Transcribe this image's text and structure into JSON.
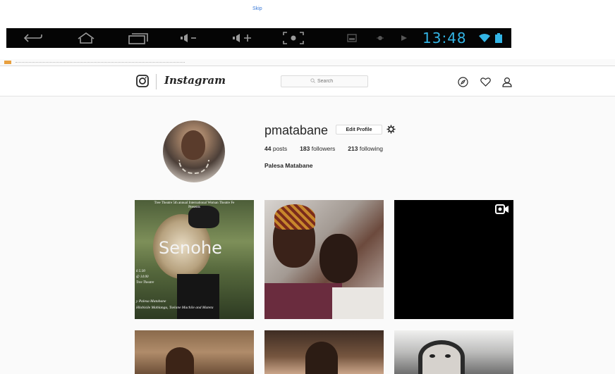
{
  "overlay": {
    "skip_label": "Skip"
  },
  "android_bar": {
    "time": "13:48",
    "icons": [
      "back-icon",
      "home-icon",
      "recents-icon",
      "volume-down-icon",
      "volume-up-icon",
      "screenshot-icon",
      "notification-icon",
      "usb-icon",
      "play-icon",
      "wifi-icon",
      "battery-icon"
    ]
  },
  "header": {
    "wordmark": "Instagram",
    "search_placeholder": "Search",
    "icons": [
      "explore-icon",
      "heart-icon",
      "profile-icon"
    ]
  },
  "profile": {
    "username": "pmatabane",
    "edit_label": "Edit Profile",
    "posts_count": "44",
    "posts_label": "posts",
    "followers_count": "183",
    "followers_label": "followers",
    "following_count": "213",
    "following_label": "following",
    "full_name": "Palesa Matabane"
  },
  "posts": {
    "poster": {
      "banner": "Tree Theatre 5th annual International Woman Theatre Fe\nPresents",
      "title": "Senohe",
      "times": "6 5:30\n@ 14:00\nTree Theatre",
      "credits": "y Palesa Matabane\nHlobisile Mahlangu, Tselane Machile and Mateta"
    }
  },
  "colors": {
    "clock": "#33b5e5",
    "link": "#3b7bd8",
    "text": "#262626"
  }
}
